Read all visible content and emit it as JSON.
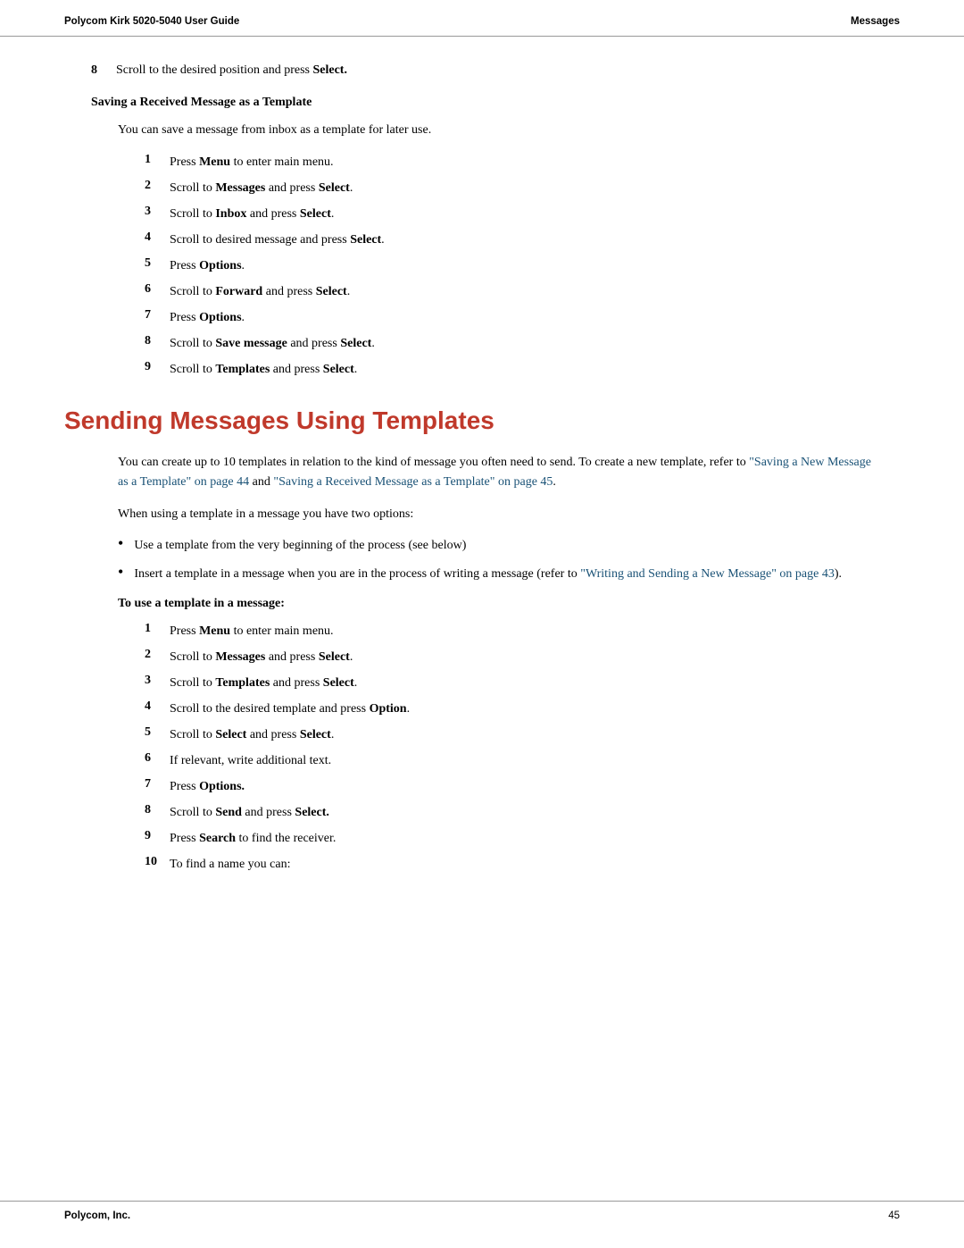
{
  "header": {
    "left": "Polycom Kirk 5020-5040 User Guide",
    "right": "Messages"
  },
  "footer": {
    "left": "Polycom, Inc.",
    "right": "45"
  },
  "top_step": {
    "number": "8",
    "text_prefix": "Scroll to the desired position and press ",
    "text_bold": "Select."
  },
  "subsection1": {
    "heading": "Saving a Received Message as a Template",
    "intro": "You can save a message from inbox as a template for later use.",
    "steps": [
      {
        "num": "1",
        "text": "Press ",
        "bold": "Menu",
        "suffix": " to enter main menu."
      },
      {
        "num": "2",
        "text": "Scroll to ",
        "bold": "Messages",
        "suffix": " and press ",
        "bold2": "Select",
        "suffix2": "."
      },
      {
        "num": "3",
        "text": "Scroll to ",
        "bold": "Inbox",
        "suffix": " and press ",
        "bold2": "Select",
        "suffix2": "."
      },
      {
        "num": "4",
        "text": "Scroll to desired message and press ",
        "bold": "Select",
        "suffix": "."
      },
      {
        "num": "5",
        "text": "Press ",
        "bold": "Options",
        "suffix": "."
      },
      {
        "num": "6",
        "text": "Scroll to ",
        "bold": "Forward",
        "suffix": " and press ",
        "bold2": "Select",
        "suffix2": "."
      },
      {
        "num": "7",
        "text": "Press ",
        "bold": "Options",
        "suffix": "."
      },
      {
        "num": "8",
        "text": "Scroll to ",
        "bold": "Save message",
        "suffix": " and press ",
        "bold2": "Select",
        "suffix2": "."
      },
      {
        "num": "9",
        "text": "Scroll to ",
        "bold": "Templates",
        "suffix": " and press ",
        "bold2": "Select",
        "suffix2": "."
      }
    ]
  },
  "section_title": "Sending Messages Using Templates",
  "section_intro": "You can create up to 10 templates in relation to the kind of message you often need to send. To create a new template, refer to ",
  "section_link1": "\"Saving a New Message as a Template\" on page 44",
  "section_link1_mid": " and ",
  "section_link2": "\"Saving a Received Message as a Template\" on page 45",
  "section_intro_end": ".",
  "section_para2": "When using a template in a message you have two options:",
  "bullets": [
    {
      "text": "Use a template from the very beginning of the process (see below)"
    },
    {
      "text": "Insert a template in a message when you are in the process of writing a message (refer to ",
      "link": "\"Writing and Sending a New Message\" on page 43",
      "suffix": ")."
    }
  ],
  "subsection2": {
    "heading": "To use a template in a message:",
    "steps": [
      {
        "num": "1",
        "text": "Press ",
        "bold": "Menu",
        "suffix": " to enter main menu."
      },
      {
        "num": "2",
        "text": "Scroll to ",
        "bold": "Messages",
        "suffix": " and press ",
        "bold2": "Select",
        "suffix2": "."
      },
      {
        "num": "3",
        "text": "Scroll to ",
        "bold": "Templates",
        "suffix": " and press ",
        "bold2": "Select",
        "suffix2": "."
      },
      {
        "num": "4",
        "text": "Scroll to the desired template and press ",
        "bold": "Option",
        "suffix": "."
      },
      {
        "num": "5",
        "text": "Scroll to ",
        "bold": "Select",
        "suffix": " and press ",
        "bold2": "Select",
        "suffix2": "."
      },
      {
        "num": "6",
        "text": "If relevant, write additional text."
      },
      {
        "num": "7",
        "text": "Press ",
        "bold": "Options.",
        "suffix": ""
      },
      {
        "num": "8",
        "text": "Scroll to ",
        "bold": "Send",
        "suffix": " and press ",
        "bold2": "Select.",
        "suffix2": ""
      },
      {
        "num": "9",
        "text": "Press ",
        "bold": "Search",
        "suffix": " to find the receiver."
      },
      {
        "num": "10",
        "text": "To find a name you can:"
      }
    ]
  }
}
